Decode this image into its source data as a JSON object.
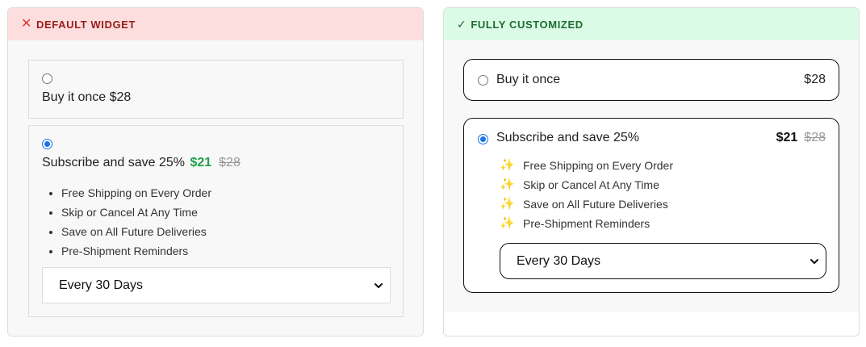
{
  "default_widget": {
    "header": "DEFAULT WIDGET",
    "header_icon": "x-icon",
    "once_option": {
      "label": "Buy it once $28",
      "selected": false
    },
    "subscribe_option": {
      "label": "Subscribe and save 25%",
      "price": "$21",
      "original_price": "$28",
      "selected": true,
      "benefits": [
        "Free Shipping on Every Order",
        "Skip or Cancel At Any Time",
        "Save on All Future Deliveries",
        "Pre-Shipment Reminders"
      ]
    },
    "frequency_select": {
      "value": "Every 30 Days"
    }
  },
  "custom_widget": {
    "header": "FULLY CUSTOMIZED",
    "header_icon": "check-icon",
    "once_option": {
      "label": "Buy it once",
      "price": "$28",
      "selected": false
    },
    "subscribe_option": {
      "label": "Subscribe and save 25%",
      "price": "$21",
      "original_price": "$28",
      "selected": true,
      "benefit_icon": "sparkles-icon",
      "benefits": [
        "Free Shipping on Every Order",
        "Skip or Cancel At Any Time",
        "Save on All Future Deliveries",
        "Pre-Shipment Reminders"
      ]
    },
    "frequency_select": {
      "value": "Every 30 Days"
    }
  },
  "colors": {
    "bad_header_bg": "#fcdede",
    "bad_header_text": "#9b1c1c",
    "good_header_bg": "#dcfbe6",
    "good_header_text": "#1d6b34",
    "price_green": "#1fa14a",
    "radio_accent": "#1a73e8"
  }
}
